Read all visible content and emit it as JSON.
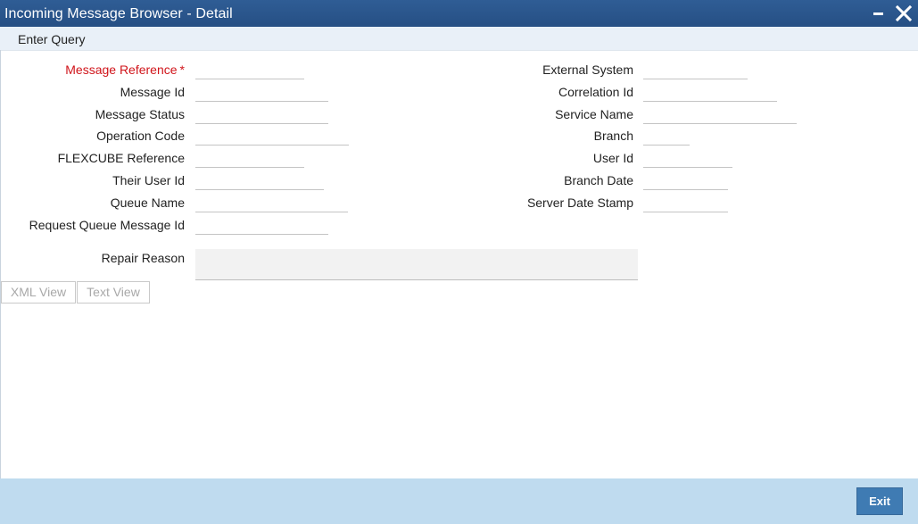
{
  "window": {
    "title": "Incoming Message Browser - Detail"
  },
  "toolbar": {
    "enter_query": "Enter Query"
  },
  "left_fields": [
    {
      "label": "Message Reference",
      "required": true,
      "value": ""
    },
    {
      "label": "Message Id",
      "value": ""
    },
    {
      "label": "Message Status",
      "value": ""
    },
    {
      "label": "Operation Code",
      "value": ""
    },
    {
      "label": "FLEXCUBE Reference",
      "value": ""
    },
    {
      "label": "Their User Id",
      "value": ""
    },
    {
      "label": "Queue Name",
      "value": ""
    },
    {
      "label": "Request Queue Message Id",
      "value": ""
    }
  ],
  "right_fields": [
    {
      "label": "External System",
      "value": ""
    },
    {
      "label": "Correlation Id",
      "value": ""
    },
    {
      "label": "Service Name",
      "value": ""
    },
    {
      "label": "Branch",
      "value": ""
    },
    {
      "label": "User Id",
      "value": ""
    },
    {
      "label": "Branch Date",
      "value": ""
    },
    {
      "label": "Server Date Stamp",
      "value": ""
    }
  ],
  "repair": {
    "label": "Repair Reason",
    "value": ""
  },
  "view_buttons": {
    "xml_view": "XML View",
    "text_view": "Text View"
  },
  "footer": {
    "exit_label": "Exit"
  },
  "required_marker": "*",
  "colors": {
    "titlebar": "#2b5890",
    "toolbar": "#e9f0f8",
    "footer": "#bfdbef",
    "exit_button": "#3f7bb3",
    "required_label": "#d0141a"
  }
}
